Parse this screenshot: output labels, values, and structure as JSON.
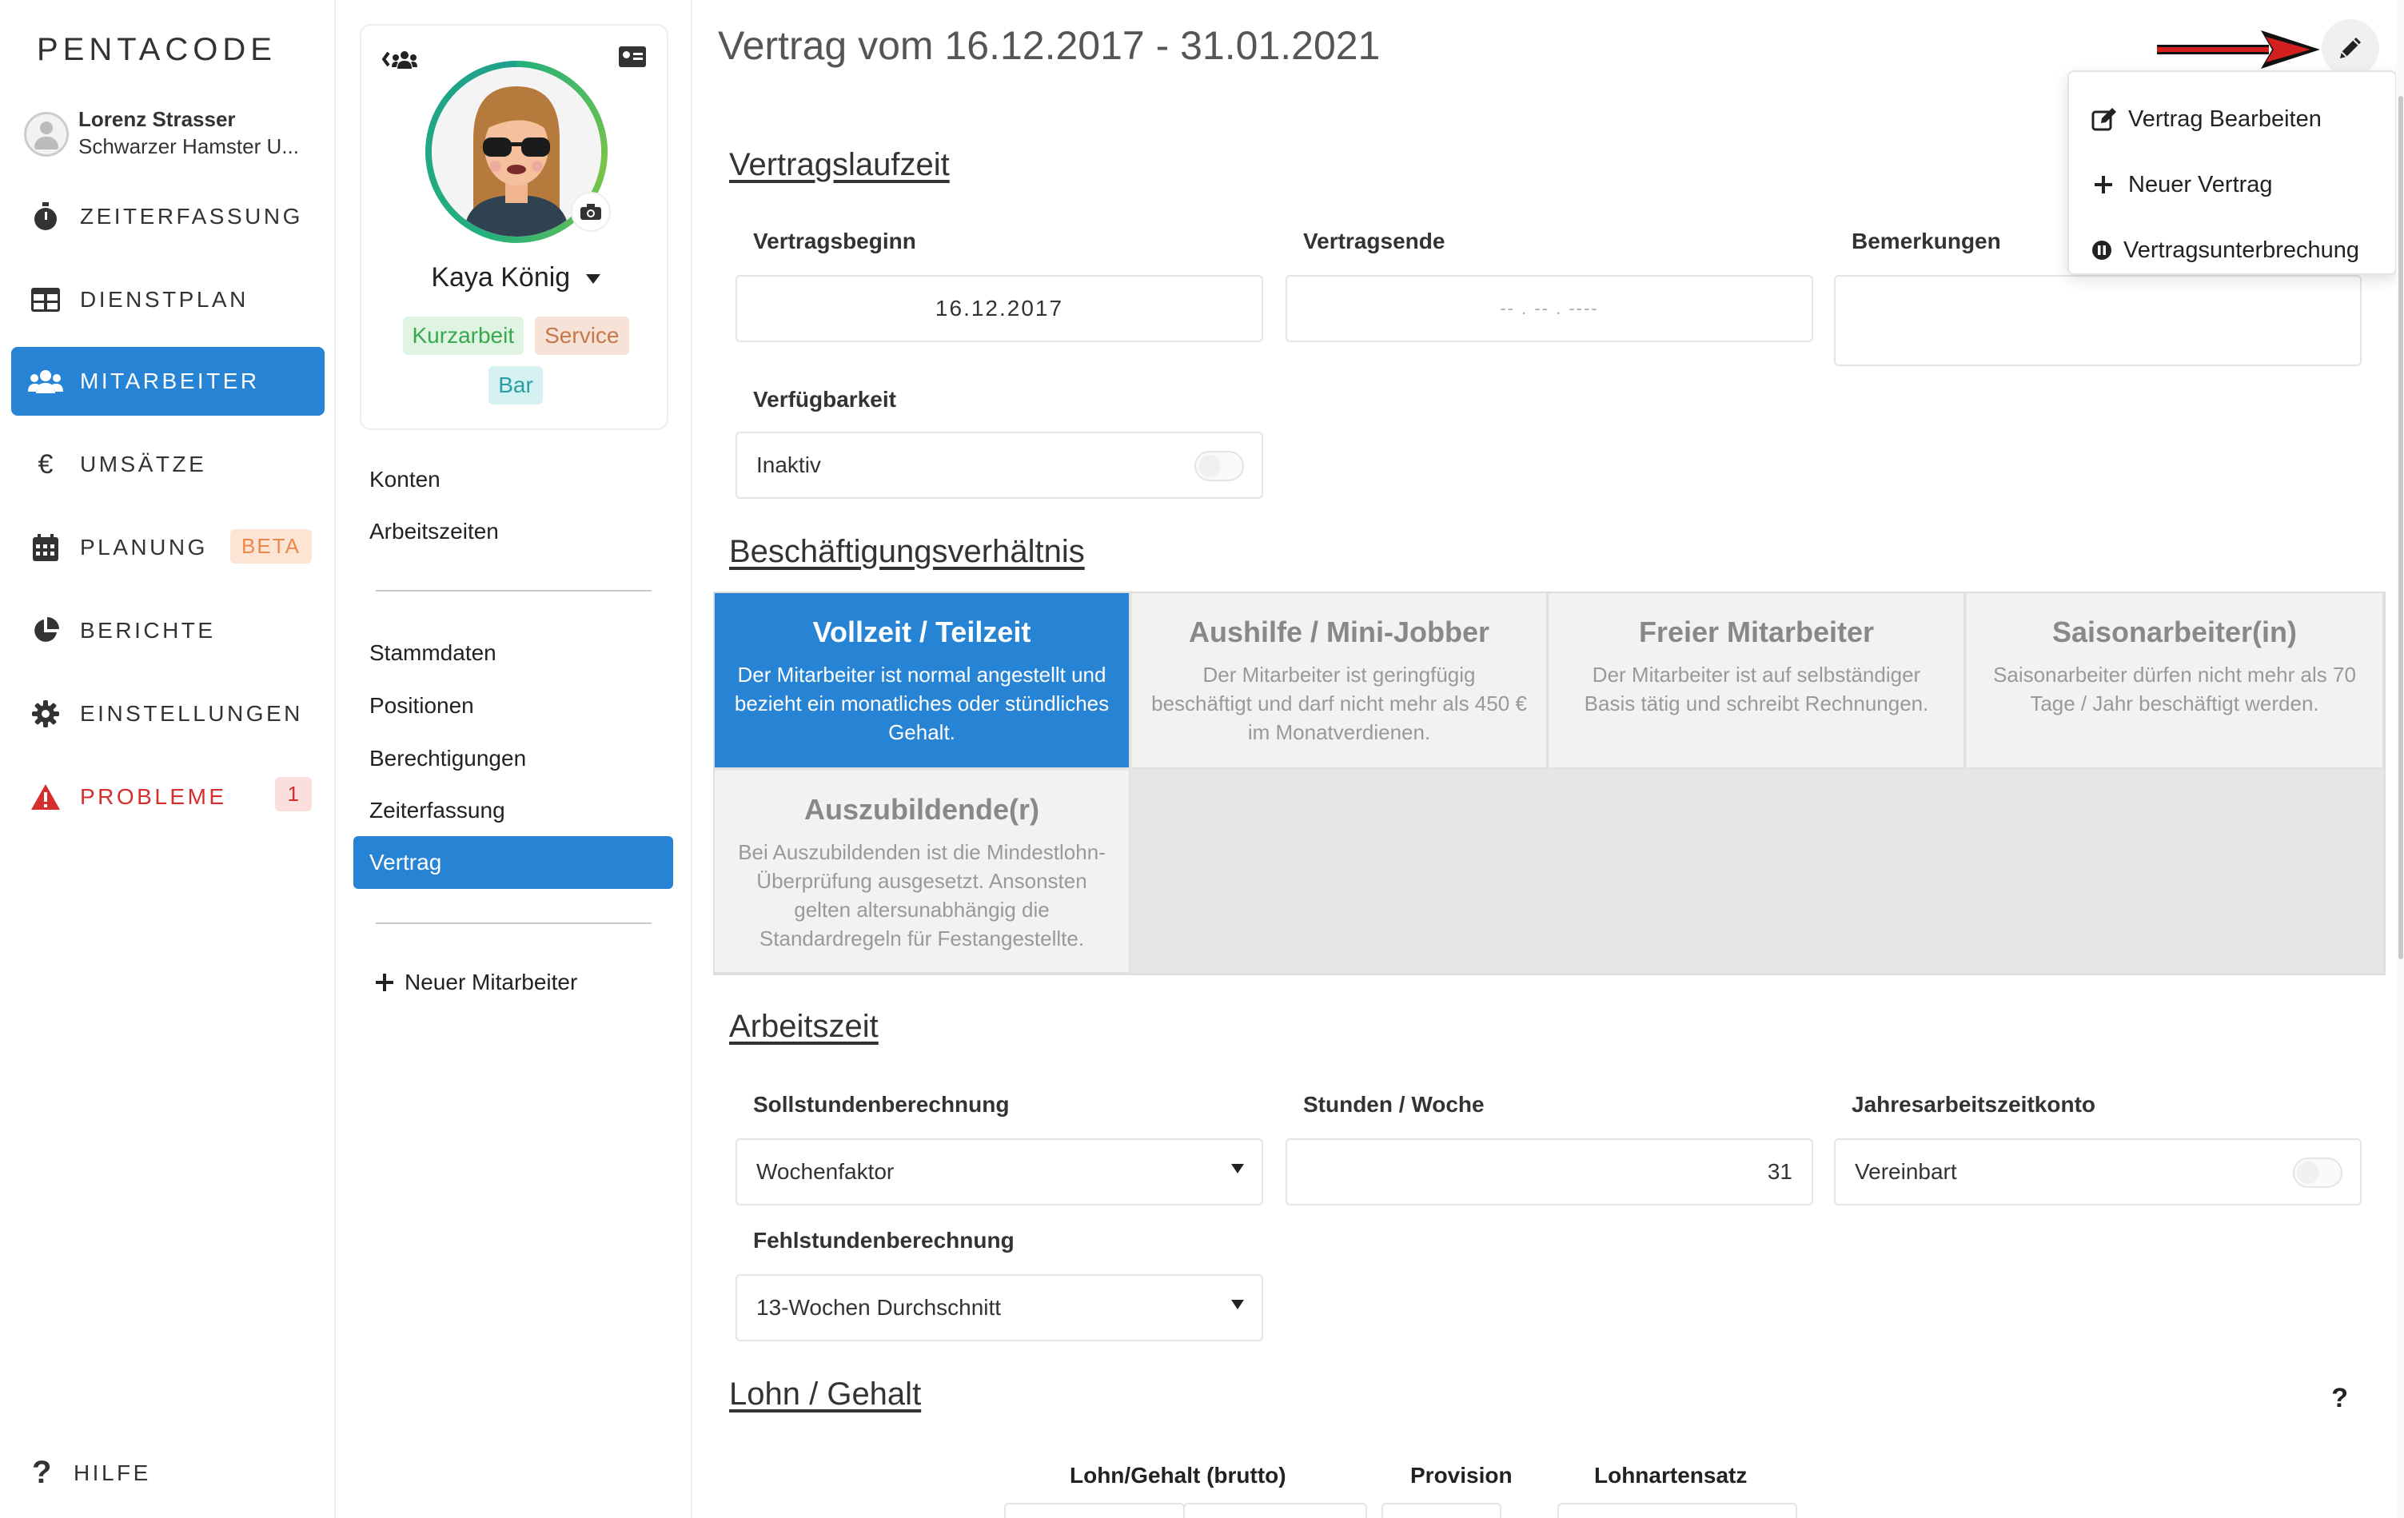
{
  "app": {
    "logo": "PENTACODE",
    "user_name": "Lorenz Strasser",
    "user_company": "Schwarzer Hamster U..."
  },
  "nav": [
    {
      "id": "zeiterfassung",
      "label": "ZEITERFASSUNG",
      "icon": "stopwatch-icon"
    },
    {
      "id": "dienstplan",
      "label": "DIENSTPLAN",
      "icon": "table-icon"
    },
    {
      "id": "mitarbeiter",
      "label": "MITARBEITER",
      "icon": "users-icon",
      "active": true
    },
    {
      "id": "umsaetze",
      "label": "UMSÄTZE",
      "icon": "euro-icon"
    },
    {
      "id": "planung",
      "label": "PLANUNG",
      "icon": "calendar-icon",
      "badge": "BETA"
    },
    {
      "id": "berichte",
      "label": "BERICHTE",
      "icon": "pie-chart-icon"
    },
    {
      "id": "einstellungen",
      "label": "EINSTELLUNGEN",
      "icon": "gear-icon"
    },
    {
      "id": "probleme",
      "label": "PROBLEME",
      "icon": "warning-icon",
      "badge": "1"
    }
  ],
  "help_label": "HILFE",
  "profile": {
    "name": "Kaya König",
    "tags": [
      "Kurzarbeit",
      "Service",
      "Bar"
    ]
  },
  "subnav": {
    "group1": [
      "Konten",
      "Arbeitszeiten"
    ],
    "group2": [
      "Stammdaten",
      "Positionen",
      "Berechtigungen",
      "Zeiterfassung",
      "Vertrag"
    ],
    "new_employee": "Neuer Mitarbeiter"
  },
  "page_title": "Vertrag vom 16.12.2017 - 31.01.2021",
  "dropdown": {
    "items": [
      "Vertrag Bearbeiten",
      "Neuer Vertrag",
      "Vertragsunterbrechung"
    ]
  },
  "laufzeit": {
    "title": "Vertragslaufzeit",
    "beginn_label": "Vertragsbeginn",
    "beginn_value": "16.12.2017",
    "ende_label": "Vertragsende",
    "ende_placeholder": "-- . -- . ----",
    "bemerkungen_label": "Bemerkungen",
    "verfuegbarkeit_label": "Verfügbarkeit",
    "verfuegbarkeit_value": "Inaktiv"
  },
  "beschaeftigung": {
    "title": "Beschäftigungsverhältnis",
    "options": [
      {
        "title": "Vollzeit / Teilzeit",
        "desc": "Der Mitarbeiter ist normal angestellt und bezieht ein monatliches oder stündliches Gehalt.",
        "active": true
      },
      {
        "title": "Aushilfe / Mini-Jobber",
        "desc": "Der Mitarbeiter ist geringfügig beschäftigt und darf nicht mehr als 450 € im Monatverdienen."
      },
      {
        "title": "Freier Mitarbeiter",
        "desc": "Der Mitarbeiter ist auf selbständiger Basis tätig und schreibt Rechnungen."
      },
      {
        "title": "Saisonarbeiter(in)",
        "desc": "Saisonarbeiter dürfen nicht mehr als 70 Tage / Jahr beschäftigt werden."
      },
      {
        "title": "Auszubildende(r)",
        "desc": "Bei Auszubildenden ist die Mindestlohn-Überprüfung ausgesetzt. Ansonsten gelten altersunabhängig die Standardregeln für Festangestellte."
      }
    ]
  },
  "arbeitszeit": {
    "title": "Arbeitszeit",
    "soll_label": "Sollstundenberechnung",
    "soll_value": "Wochenfaktor",
    "stunden_label": "Stunden / Woche",
    "stunden_value": "31",
    "jahres_label": "Jahresarbeitszeitkonto",
    "jahres_value": "Vereinbart",
    "fehl_label": "Fehlstundenberechnung",
    "fehl_value": "13-Wochen Durchschnitt"
  },
  "lohn": {
    "title": "Lohn / Gehalt",
    "help": "?",
    "columns": [
      "Lohn/Gehalt (brutto)",
      "Provision",
      "Lohnartensatz"
    ]
  },
  "colors": {
    "accent": "#2783d4",
    "danger": "#d62d2d",
    "beta_bg": "#fde5d6",
    "beta_fg": "#f0874a"
  }
}
